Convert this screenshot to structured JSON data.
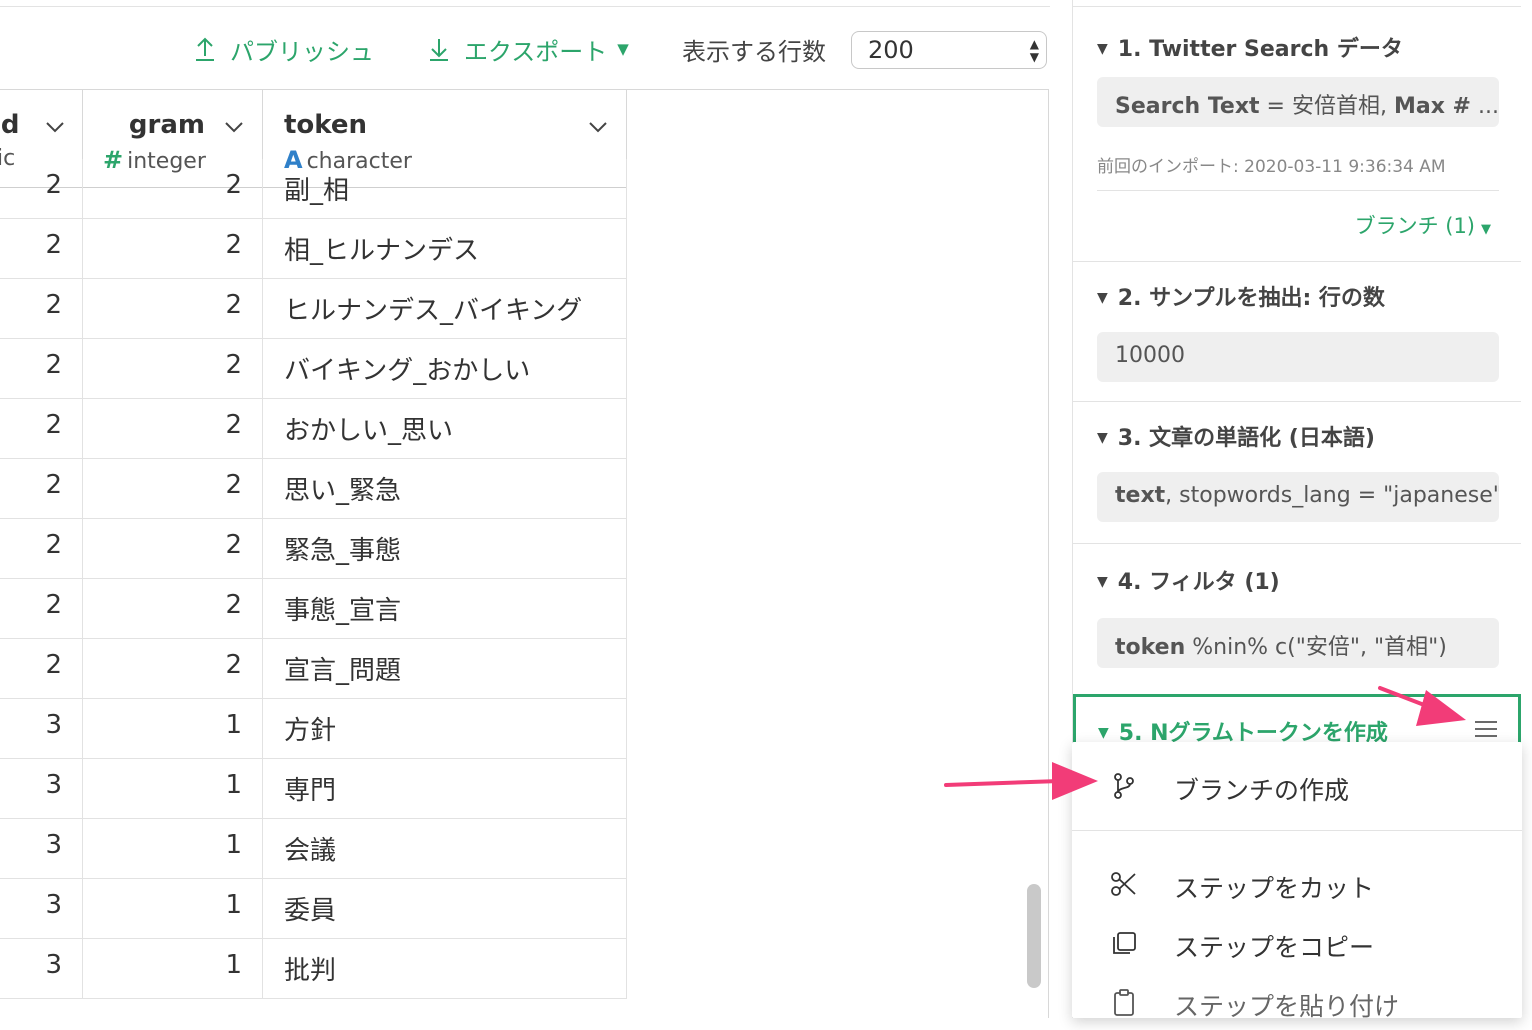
{
  "toolbar": {
    "publish_label": "パブリッシュ",
    "export_label": "エクスポート",
    "rows_label": "表示する行数",
    "rows_value": "200",
    "accent_color": "#2ca56b"
  },
  "columns": [
    {
      "name": "id",
      "type_icon": "",
      "type": "ric"
    },
    {
      "name": "gram",
      "type_icon": "#",
      "type": "integer"
    },
    {
      "name": "token",
      "type_icon": "A",
      "type": "character"
    }
  ],
  "rows": [
    {
      "id": "2",
      "gram": "2",
      "token": "副_相"
    },
    {
      "id": "2",
      "gram": "2",
      "token": "相_ヒルナンデス"
    },
    {
      "id": "2",
      "gram": "2",
      "token": "ヒルナンデス_バイキング"
    },
    {
      "id": "2",
      "gram": "2",
      "token": "バイキング_おかしい"
    },
    {
      "id": "2",
      "gram": "2",
      "token": "おかしい_思い"
    },
    {
      "id": "2",
      "gram": "2",
      "token": "思い_緊急"
    },
    {
      "id": "2",
      "gram": "2",
      "token": "緊急_事態"
    },
    {
      "id": "2",
      "gram": "2",
      "token": "事態_宣言"
    },
    {
      "id": "2",
      "gram": "2",
      "token": "宣言_問題"
    },
    {
      "id": "3",
      "gram": "1",
      "token": "方針"
    },
    {
      "id": "3",
      "gram": "1",
      "token": "専門"
    },
    {
      "id": "3",
      "gram": "1",
      "token": "会議"
    },
    {
      "id": "3",
      "gram": "1",
      "token": "委員"
    },
    {
      "id": "3",
      "gram": "1",
      "token": "批判"
    }
  ],
  "steps": {
    "step1": {
      "title": "1. Twitter Search データ",
      "box_key": "Search Text",
      "box_rest": " = 安倍首相, ",
      "box_key2": "Max #",
      "box_tail": " ...",
      "last_import": "前回のインポート: 2020-03-11 9:36:34 AM",
      "branch_label": "ブランチ (1)"
    },
    "step2": {
      "title": "2. サンプルを抽出: 行の数",
      "box": "10000"
    },
    "step3": {
      "title": "3. 文章の単語化 (日本語)",
      "box_key": "text",
      "box_rest": ", stopwords_lang = \"japanese\""
    },
    "step4": {
      "title": "4. フィルタ (1)",
      "box_key": "token",
      "box_rest": " %nin% c(\"安倍\", \"首相\")"
    },
    "step5": {
      "title": "5. Nグラムトークンを作成"
    }
  },
  "menu": {
    "create_branch": "ブランチの作成",
    "cut_step": "ステップをカット",
    "copy_step": "ステップをコピー",
    "paste_step": "ステップを貼り付け"
  },
  "icons": {
    "publish": "upload-icon",
    "export": "download-icon",
    "branch": "git-branch-icon",
    "cut": "scissors-icon",
    "copy": "copy-icon",
    "paste": "clipboard-icon",
    "menu": "hamburger-menu-icon"
  },
  "annotation_color": "#f23c78"
}
